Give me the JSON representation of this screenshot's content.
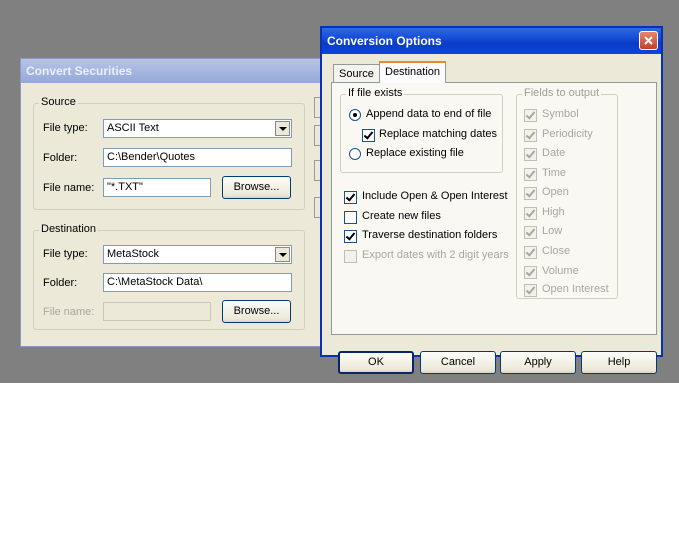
{
  "convert_securities": {
    "title": "Convert Securities",
    "source": {
      "group_label": "Source",
      "file_type_label": "File type:",
      "file_type_value": "ASCII Text",
      "folder_label": "Folder:",
      "folder_value": "C:\\Bender\\Quotes",
      "file_name_label": "File name:",
      "file_name_value": "\"*.TXT\"",
      "browse_label": "Browse..."
    },
    "destination": {
      "group_label": "Destination",
      "file_type_label": "File type:",
      "file_type_value": "MetaStock",
      "folder_label": "Folder:",
      "folder_value": "C:\\MetaStock Data\\",
      "file_name_label": "File name:",
      "file_name_value": "",
      "browse_label": "Browse..."
    }
  },
  "conversion_options": {
    "title": "Conversion Options",
    "tabs": [
      {
        "label": "Source",
        "active": false
      },
      {
        "label": "Destination",
        "active": true
      }
    ],
    "if_file_exists": {
      "group_label": "If file exists",
      "append_label": "Append data to end of file",
      "append_selected": true,
      "replace_matching_label": "Replace matching dates",
      "replace_matching_checked": true,
      "replace_existing_label": "Replace existing file",
      "replace_existing_selected": false
    },
    "options": [
      {
        "label": "Include Open & Open Interest",
        "checked": true,
        "enabled": true
      },
      {
        "label": "Create new files",
        "checked": false,
        "enabled": true
      },
      {
        "label": "Traverse destination folders",
        "checked": true,
        "enabled": true
      },
      {
        "label": "Export dates with 2 digit years",
        "checked": false,
        "enabled": false
      }
    ],
    "fields_to_output": {
      "group_label": "Fields to output",
      "fields": [
        {
          "label": "Symbol",
          "checked": true
        },
        {
          "label": "Periodicity",
          "checked": true
        },
        {
          "label": "Date",
          "checked": true
        },
        {
          "label": "Time",
          "checked": true
        },
        {
          "label": "Open",
          "checked": true
        },
        {
          "label": "High",
          "checked": true
        },
        {
          "label": "Low",
          "checked": true
        },
        {
          "label": "Close",
          "checked": true
        },
        {
          "label": "Volume",
          "checked": true
        },
        {
          "label": "Open Interest",
          "checked": true
        }
      ]
    },
    "buttons": {
      "ok": "OK",
      "cancel": "Cancel",
      "apply": "Apply",
      "help": "Help"
    }
  },
  "colors": {
    "desktop": "#808080",
    "dialog_face": "#ece9d8",
    "active_title": "#0a3cc8",
    "inactive_title": "#95a8d8",
    "close_button": "#c4402a"
  }
}
